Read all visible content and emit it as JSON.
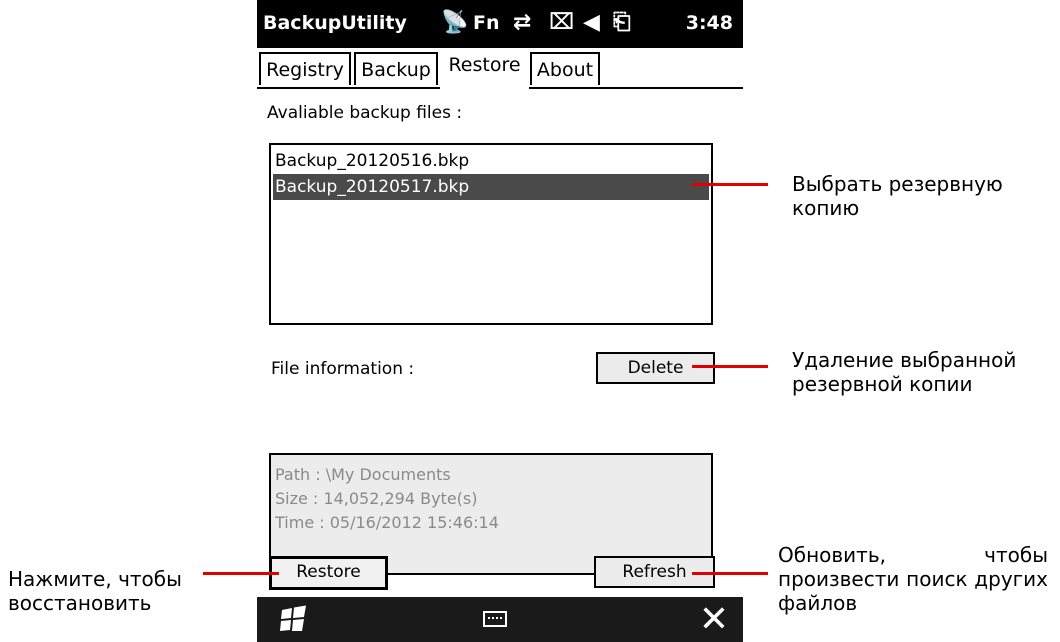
{
  "status_bar": {
    "app_title": "BackupUtility",
    "fn_label": "Fn",
    "time": "3:48"
  },
  "tabs": [
    {
      "label": "Registry"
    },
    {
      "label": "Backup"
    },
    {
      "label": "Restore"
    },
    {
      "label": "About"
    }
  ],
  "restore": {
    "available_label": "Avaliable backup files :",
    "files": [
      "Backup_20120516.bkp",
      "Backup_20120517.bkp"
    ],
    "selected_file": "Backup_20120517.bkp",
    "file_info_label": "File information :",
    "delete_label": "Delete",
    "info": {
      "path": "Path : \\My Documents",
      "size": "Size : 14,052,294 Byte(s)",
      "time": "Time : 05/16/2012 15:46:14"
    },
    "restore_label": "Restore",
    "refresh_label": "Refresh"
  },
  "annotations": {
    "select_backup": "Выбрать резервную копию",
    "delete_backup": "Удаление выбранной резервной копии",
    "refresh": "Обновить, чтобы произвести поиск других файлов",
    "restore": "Нажмите, чтобы восстановить"
  },
  "colors": {
    "annotation_line": "#e00000",
    "selection": "#4a4a4a"
  }
}
